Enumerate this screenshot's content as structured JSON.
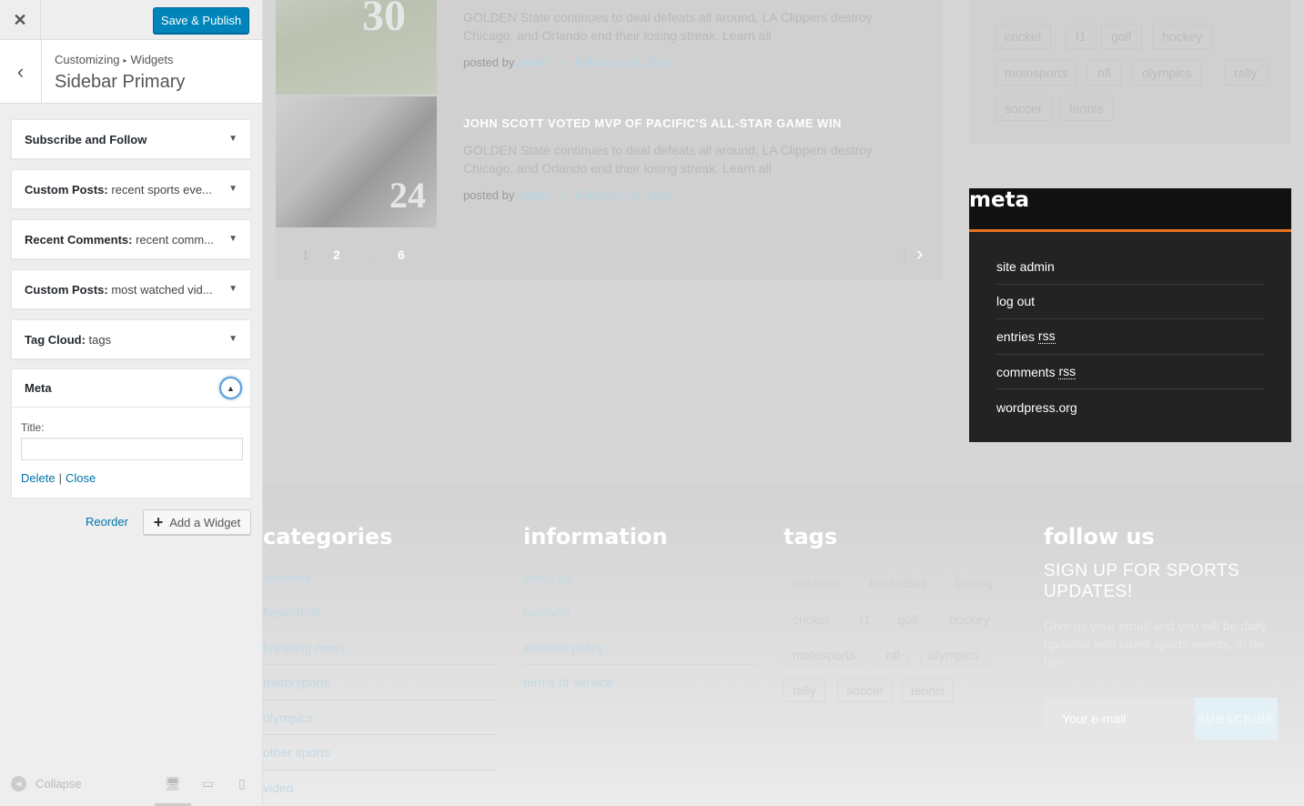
{
  "customizer": {
    "close_icon": "close-icon",
    "save_label": "Save & Publish",
    "breadcrumb": {
      "root": "Customizing",
      "current": "Widgets"
    },
    "panel_title": "Sidebar Primary",
    "widgets": [
      {
        "type": "Subscribe and Follow",
        "title": ""
      },
      {
        "type": "Custom Posts:",
        "title": " recent sports eve..."
      },
      {
        "type": "Recent Comments:",
        "title": " recent comm..."
      },
      {
        "type": "Custom Posts:",
        "title": " most watched vid..."
      },
      {
        "type": "Tag Cloud:",
        "title": " tags"
      }
    ],
    "meta_widget": {
      "type": "Meta",
      "title_label": "Title:",
      "title_value": "",
      "delete_label": "Delete",
      "separator": "|",
      "close_label": "Close"
    },
    "reorder_label": "Reorder",
    "add_widget_label": "Add a Widget",
    "collapse_label": "Collapse",
    "colors": {
      "primary_button": "#0085ba",
      "link": "#0073aa",
      "focus_ring": "#5b9dd9"
    }
  },
  "preview": {
    "posts": [
      {
        "excerpt": "GOLDEN State continues to deal defeats all around, LA Clippers destroy Chicago, and Orlando end their losing streak. Learn all",
        "posted_by": "posted by",
        "author": "Admin",
        "bullet": "•",
        "date": "February 24, 2016",
        "image_text": "30"
      },
      {
        "title": "JOHN SCOTT VOTED MVP OF PACIFIC'S ALL-STAR GAME WIN",
        "excerpt": "GOLDEN State continues to deal defeats all around, LA Clippers destroy Chicago, and Orlando end their losing streak. Learn all",
        "posted_by": "posted by",
        "author": "Admin",
        "bullet": "•",
        "date": "February 24, 2016",
        "image_text": "24"
      }
    ],
    "pagination": [
      "1",
      "2",
      "...",
      "6"
    ],
    "pagination_next": "›",
    "top_tags": [
      "cricket",
      "f1",
      "golf",
      "hockey",
      "motosports",
      "nfl",
      "olympics",
      "rally",
      "soccer",
      "tennis"
    ],
    "meta": {
      "heading": "meta",
      "items": [
        {
          "text": "site admin"
        },
        {
          "text": "log out"
        },
        {
          "text": "entries ",
          "abbr": "rss"
        },
        {
          "text": "comments ",
          "abbr": "rss"
        },
        {
          "text": "wordpress.org"
        }
      ],
      "accent_color": "#e8731f"
    },
    "footer": {
      "categories": {
        "title": "categories",
        "links": [
          "baseball",
          "basketball",
          "breaking news",
          "motorsports",
          "olympics",
          "other sports",
          "video"
        ]
      },
      "information": {
        "title": "information",
        "links": [
          "about us",
          "contacts",
          "editorial policy",
          "terms of service"
        ]
      },
      "tags": {
        "title": "tags",
        "items": [
          "baseball",
          "basketball",
          "boxing",
          "cricket",
          "f1",
          "golf",
          "hockey",
          "motosports",
          "nfl",
          "olympics",
          "rally",
          "soccer",
          "tennis"
        ]
      },
      "follow": {
        "title": "follow us",
        "signup_heading": "SIGN UP FOR SPORTS UPDATES!",
        "signup_text": "Give us your email and you will be daily updated with latest sports events, in de-tail!",
        "email_placeholder": "Your e-mail",
        "subscribe_label": "SUBSCRIBE"
      }
    }
  }
}
